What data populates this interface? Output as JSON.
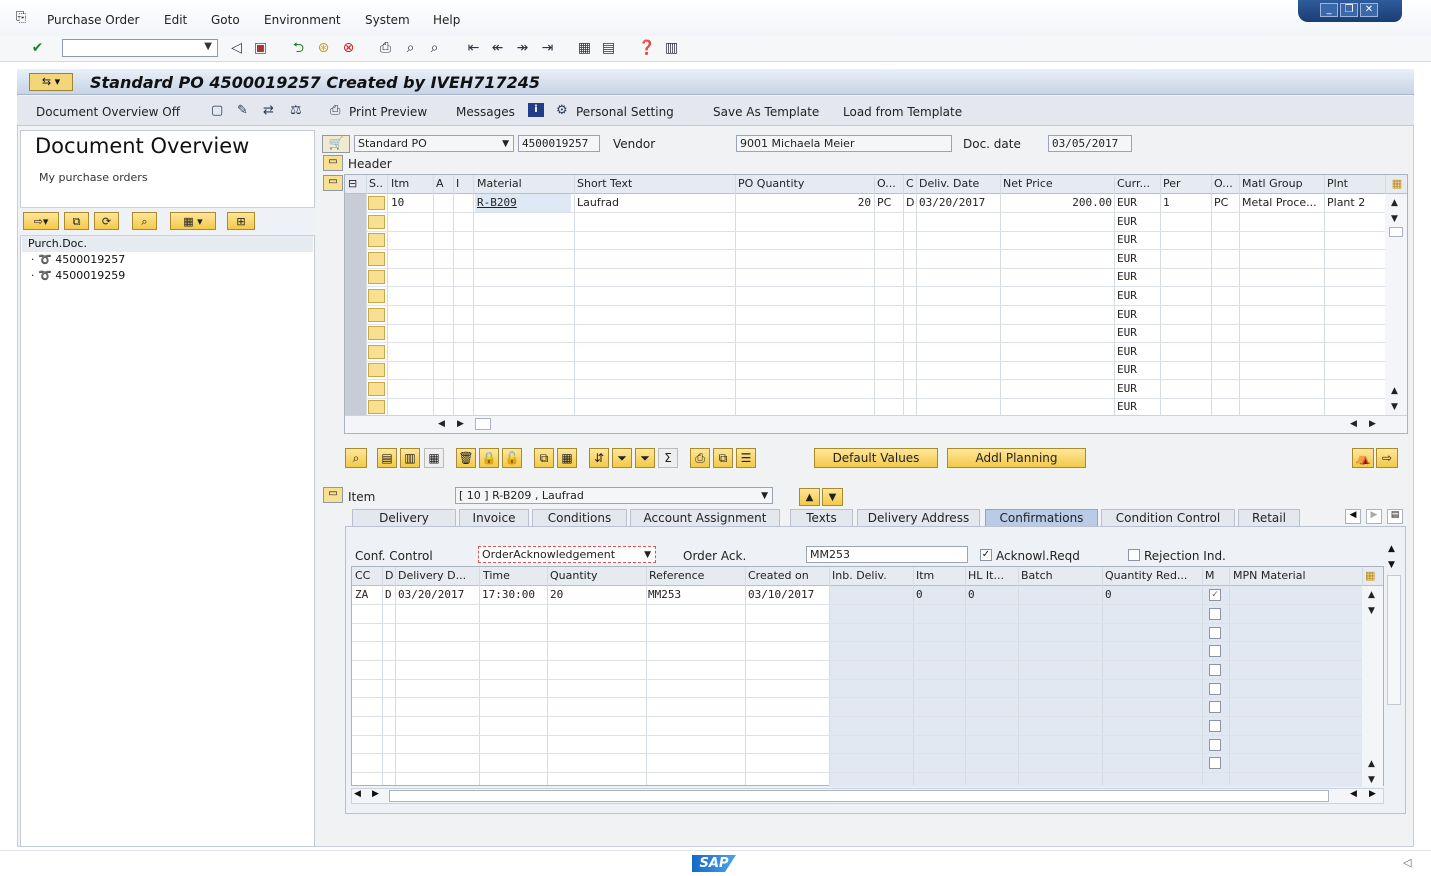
{
  "menubar": {
    "items": [
      "Purchase Order",
      "Edit",
      "Goto",
      "Environment",
      "System",
      "Help"
    ]
  },
  "title": "Standard PO 4500019257 Created by IVEH717245",
  "app_toolbar": {
    "doc_overview_off": "Document Overview Off",
    "print_preview": "Print Preview",
    "messages": "Messages",
    "personal_setting": "Personal Setting",
    "save_as_template": "Save As Template",
    "load_from_template": "Load from Template"
  },
  "left_panel": {
    "heading": "Document Overview",
    "subheading": "My purchase orders",
    "tree_header": "Purch.Doc.",
    "docs": [
      "4500019257",
      "4500019259"
    ]
  },
  "header": {
    "doc_type": "Standard PO",
    "po_number": "4500019257",
    "vendor_label": "Vendor",
    "vendor": "9001 Michaela Meier",
    "doc_date_label": "Doc. date",
    "doc_date": "03/05/2017",
    "header_label": "Header"
  },
  "items_table": {
    "columns": [
      "S..",
      "Itm",
      "A",
      "I",
      "Material",
      "Short Text",
      "PO Quantity",
      "O...",
      "C",
      "Deliv. Date",
      "Net Price",
      "Curr...",
      "Per",
      "O...",
      "Matl Group",
      "Plnt"
    ],
    "row": {
      "itm": "10",
      "material": "R-B209",
      "short_text": "Laufrad",
      "qty": "20",
      "uom": "PC",
      "cat": "D",
      "deliv_date": "03/20/2017",
      "net_price": "200.00",
      "curr": "EUR",
      "per": "1",
      "oun": "PC",
      "matl_group": "Metal Proce...",
      "plnt": "Plant 2"
    },
    "empty_curr": "EUR"
  },
  "buttons": {
    "default_values": "Default Values",
    "addl_planning": "Addl Planning"
  },
  "item_detail": {
    "label": "Item",
    "selected": "[ 10 ] R-B209 , Laufrad"
  },
  "tabs": [
    "Delivery",
    "Invoice",
    "Conditions",
    "Account Assignment",
    "Texts",
    "Delivery Address",
    "Confirmations",
    "Condition Control",
    "Retail"
  ],
  "confirmations": {
    "conf_control_label": "Conf. Control",
    "conf_control": "OrderAcknowledgement",
    "order_ack_label": "Order Ack.",
    "order_ack": "MM253",
    "acknowl_reqd": "Acknowl.Reqd",
    "rejection": "Rejection Ind.",
    "columns": [
      "CC",
      "D",
      "Delivery D...",
      "Time",
      "Quantity",
      "Reference",
      "Created on",
      "Inb. Deliv.",
      "Itm",
      "HL It...",
      "Batch",
      "Quantity Red...",
      "M",
      "MPN Material"
    ],
    "row": {
      "cc": "ZA",
      "d": "D",
      "date": "03/20/2017",
      "time": "17:30:00",
      "qty": "20",
      "ref": "MM253",
      "created": "03/10/2017",
      "itm": "0",
      "hl": "0",
      "qty_red": "0"
    }
  },
  "logo": "SAP"
}
